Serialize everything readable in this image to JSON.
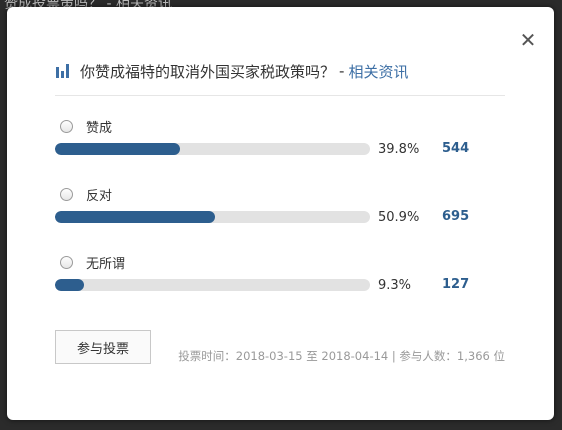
{
  "background": {
    "partial_text": "赞成投票策吗？ - 相关资讯"
  },
  "poll": {
    "question": "你赞成福特的取消外国买家税政策吗？",
    "separator": "-",
    "related_link": "相关资讯",
    "options": [
      {
        "label": "赞成",
        "percent_text": "39.8%",
        "percent": 39.8,
        "count": "544"
      },
      {
        "label": "反对",
        "percent_text": "50.9%",
        "percent": 50.9,
        "count": "695"
      },
      {
        "label": "无所谓",
        "percent_text": "9.3%",
        "percent": 9.3,
        "count": "127"
      }
    ],
    "vote_button": "参与投票",
    "footer": "投票时间：2018-03-15 至 2018-04-14 | 参与人数：1,366 位"
  },
  "icons": {
    "close": "close-icon",
    "chart": "bar-chart-icon",
    "radio": "radio-icon"
  },
  "colors": {
    "accent": "#2d5e8e",
    "link": "#3d6fa5",
    "track": "#e2e2e2",
    "overlay": "#2b2b2b"
  }
}
